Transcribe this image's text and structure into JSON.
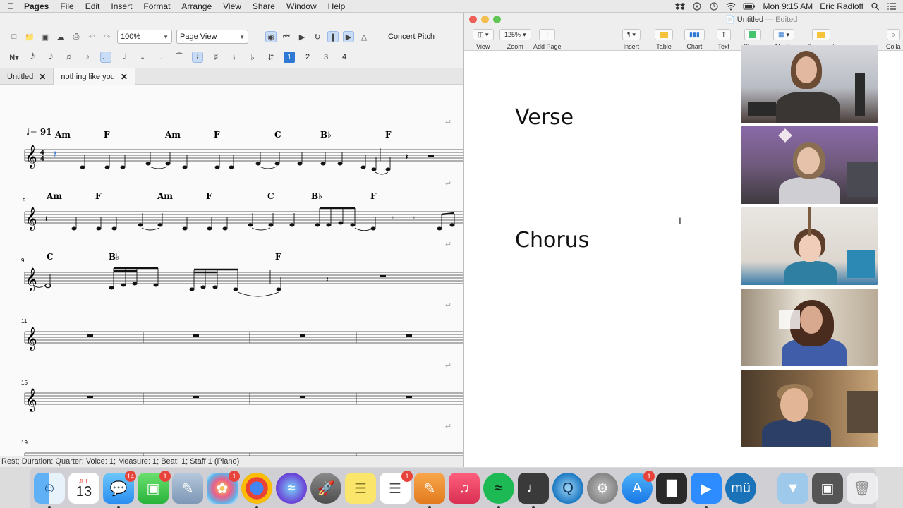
{
  "menubar": {
    "app_name": "Pages",
    "menus": [
      "File",
      "Edit",
      "Insert",
      "Format",
      "Arrange",
      "View",
      "Share",
      "Window",
      "Help"
    ],
    "clock": "Mon 9:15 AM",
    "user": "Eric Radloff"
  },
  "musescore": {
    "zoom": "100%",
    "view_mode": "Page View",
    "concert_pitch_label": "Concert Pitch",
    "voices": [
      "1",
      "2",
      "3",
      "4"
    ],
    "active_voice": "1",
    "tabs": [
      {
        "label": "Untitled",
        "active": false
      },
      {
        "label": "nothing like you",
        "active": true
      }
    ],
    "score": {
      "tempo": "♩= 91",
      "system1_chords": [
        "Am",
        "F",
        "Am",
        "F",
        "C",
        "B♭",
        "F"
      ],
      "system2_number": "5",
      "system2_chords": [
        "Am",
        "F",
        "Am",
        "F",
        "C",
        "B♭",
        "F"
      ],
      "system3_number": "9",
      "system3_chords": [
        "C",
        "B♭",
        "F"
      ],
      "system4_number": "11",
      "system5_number": "15",
      "system6_number": "19"
    },
    "status": "Rest; Duration: Quarter; Voice: 1;  Measure: 1; Beat: 1; Staff 1 (Piano)"
  },
  "pages": {
    "title": "Untitled",
    "edited": "— Edited",
    "toolbar": {
      "view": "View",
      "zoom_value": "125%",
      "zoom": "Zoom",
      "add_page": "Add Page",
      "insert": "Insert",
      "table": "Table",
      "chart": "Chart",
      "text": "Text",
      "shape": "Shape",
      "media": "Media",
      "comment": "Comment",
      "collaborate": "Colla"
    },
    "headings": {
      "verse": "Verse",
      "chorus": "Chorus"
    }
  },
  "dock": {
    "calendar_month": "JUL",
    "calendar_day": "13",
    "badges": {
      "messages": "14",
      "facetime": "1",
      "photos": "1",
      "reminders": "1",
      "appstore": "1"
    }
  }
}
